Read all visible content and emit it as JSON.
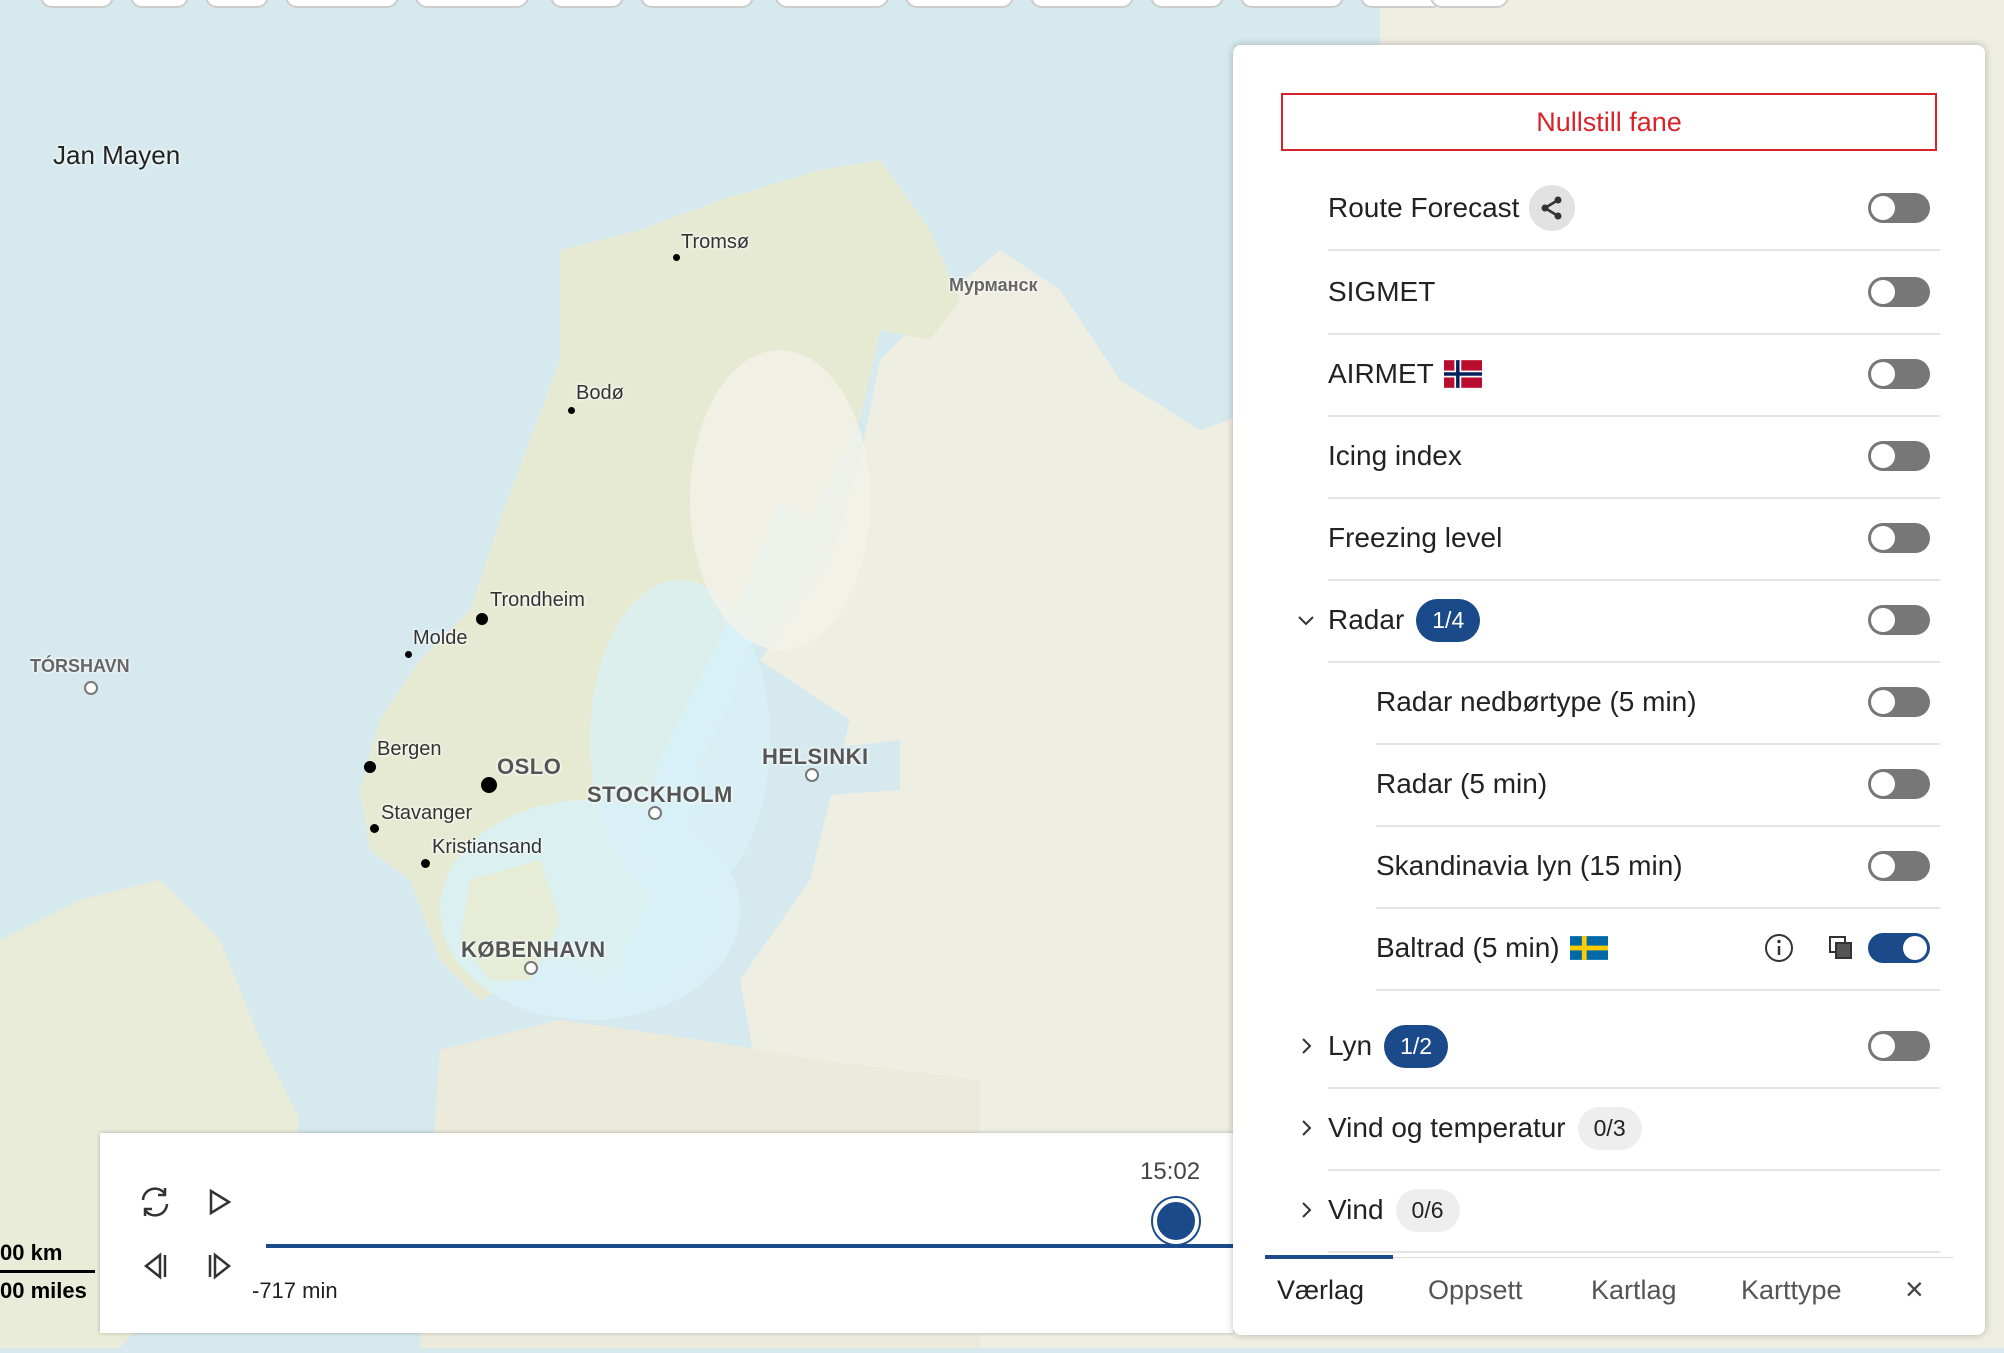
{
  "map": {
    "labels": {
      "jan_mayen": "Jan Mayen",
      "torshavn": "TÓRSHAVN",
      "tromso": "Tromsø",
      "murmansk": "Мурманск",
      "bodo": "Bodø",
      "trondheim": "Trondheim",
      "molde": "Molde",
      "bergen": "Bergen",
      "oslo": "OSLO",
      "stavanger": "Stavanger",
      "kristiansand": "Kristiansand",
      "stockholm": "STOCKHOLM",
      "helsinki": "HELSINKI",
      "kobenhavn": "KØBENHAVN"
    },
    "scale": {
      "km": "00 km",
      "miles": "00 miles"
    }
  },
  "timeline": {
    "time": "15:02",
    "offset": "-717 min",
    "position_fraction": 0.92
  },
  "panel": {
    "reset_label": "Nullstill fane",
    "rows": {
      "route_forecast": "Route Forecast",
      "sigmet": "SIGMET",
      "airmet": "AIRMET",
      "icing": "Icing index",
      "freezing": "Freezing level",
      "radar": "Radar",
      "radar_badge": "1/4",
      "radar_nedbor": "Radar nedbørtype (5 min)",
      "radar_5": "Radar (5 min)",
      "skandinavia": "Skandinavia lyn (15 min)",
      "baltrad": "Baltrad (5 min)",
      "lyn": "Lyn",
      "lyn_badge": "1/2",
      "vind_temp": "Vind og temperatur",
      "vind_temp_badge": "0/3",
      "vind": "Vind",
      "vind_badge": "0/6"
    },
    "toggles": {
      "route_forecast": false,
      "sigmet": false,
      "airmet": false,
      "icing": false,
      "freezing": false,
      "radar": false,
      "radar_nedbor": false,
      "radar_5": false,
      "skandinavia": false,
      "baltrad": true,
      "lyn": false
    },
    "tabs": [
      "Værlag",
      "Oppsett",
      "Kartlag",
      "Karttype"
    ],
    "active_tab": "Værlag"
  },
  "colors": {
    "accent": "#1b4a8a",
    "reset": "#d8232a"
  }
}
